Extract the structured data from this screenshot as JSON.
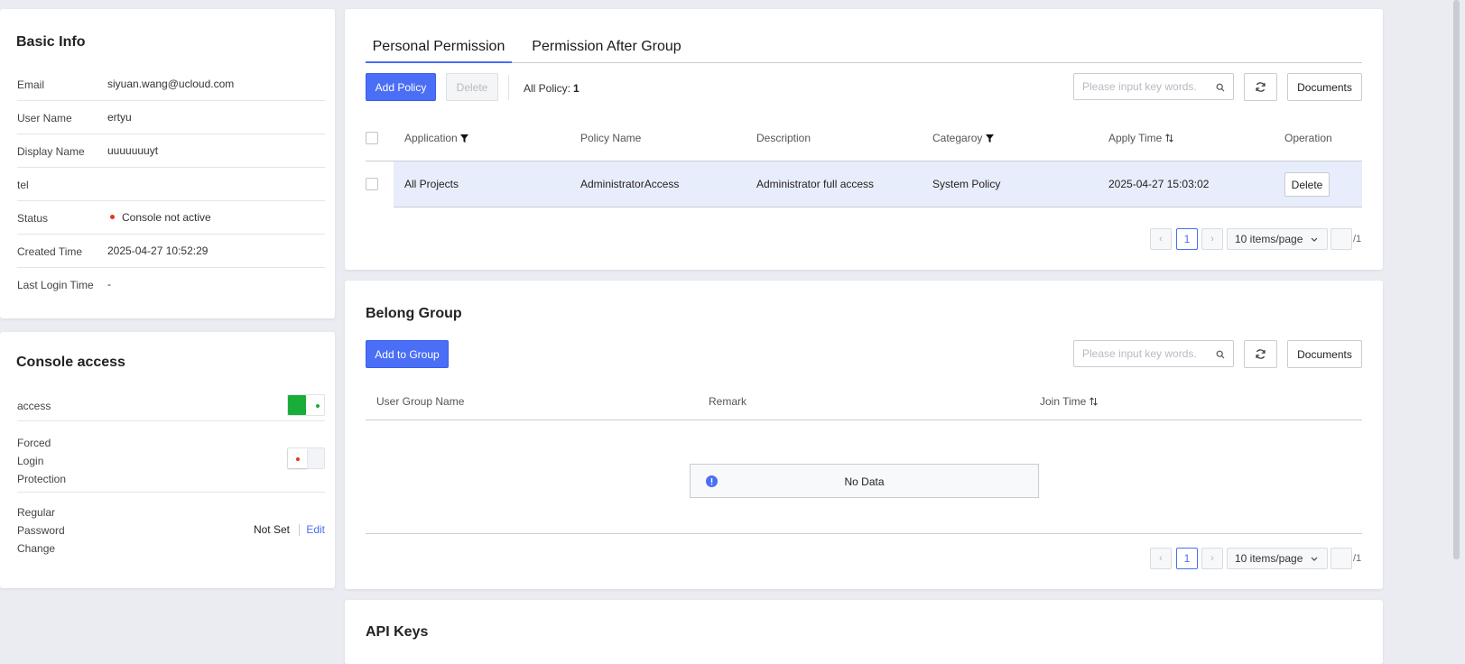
{
  "basic_info": {
    "title": "Basic Info",
    "rows": [
      {
        "label": "Email",
        "value": "siyuan.wang@ucloud.com"
      },
      {
        "label": "User Name",
        "value": "ertyu"
      },
      {
        "label": "Display Name",
        "value": "uuuuuuuyt"
      },
      {
        "label": "tel",
        "value": ""
      },
      {
        "label": "Status",
        "value": "Console not active"
      },
      {
        "label": "Created Time",
        "value": "2025-04-27 10:52:29"
      },
      {
        "label": "Last Login Time",
        "value": "-"
      }
    ],
    "status_dot_color": "#e8341c"
  },
  "console_access": {
    "title": "Console access",
    "access_label": "access",
    "access_enabled": true,
    "forced_login_label": [
      "Forced",
      "Login",
      "Protection"
    ],
    "forced_login_enabled": false,
    "password_label": [
      "Regular",
      "Password",
      "Change"
    ],
    "password_value": "Not Set",
    "edit_label": "Edit"
  },
  "permission": {
    "tabs": [
      {
        "label": "Personal Permission",
        "active": true
      },
      {
        "label": "Permission After Group",
        "active": false
      }
    ],
    "add_policy_label": "Add Policy",
    "delete_label": "Delete",
    "all_policy_label": "All Policy:",
    "all_policy_count": "1",
    "search_placeholder": "Please input key words.",
    "documents_label": "Documents",
    "columns": [
      "Application",
      "Policy Name",
      "Description",
      "Categaroy",
      "Apply Time",
      "Operation"
    ],
    "rows": [
      {
        "application": "All Projects",
        "policy_name": "AdministratorAccess",
        "description": "Administrator full access",
        "category": "System Policy",
        "apply_time": "2025-04-27 15:03:02",
        "operation": "Delete"
      }
    ],
    "pagination": {
      "current_page": "1",
      "page_size": "10 items/page",
      "total_pages": "/1"
    }
  },
  "belong_group": {
    "title": "Belong Group",
    "add_label": "Add to Group",
    "search_placeholder": "Please input key words.",
    "documents_label": "Documents",
    "columns": [
      "User Group Name",
      "Remark",
      "Join Time"
    ],
    "empty_text": "No Data",
    "pagination": {
      "current_page": "1",
      "page_size": "10 items/page",
      "total_pages": "/1"
    }
  },
  "api_keys": {
    "title": "API Keys"
  },
  "colors": {
    "accent": "#4a6ef5",
    "switch_on": "#1aad3a",
    "status_red": "#e8341c",
    "row_highlight": "#e8edfb"
  }
}
